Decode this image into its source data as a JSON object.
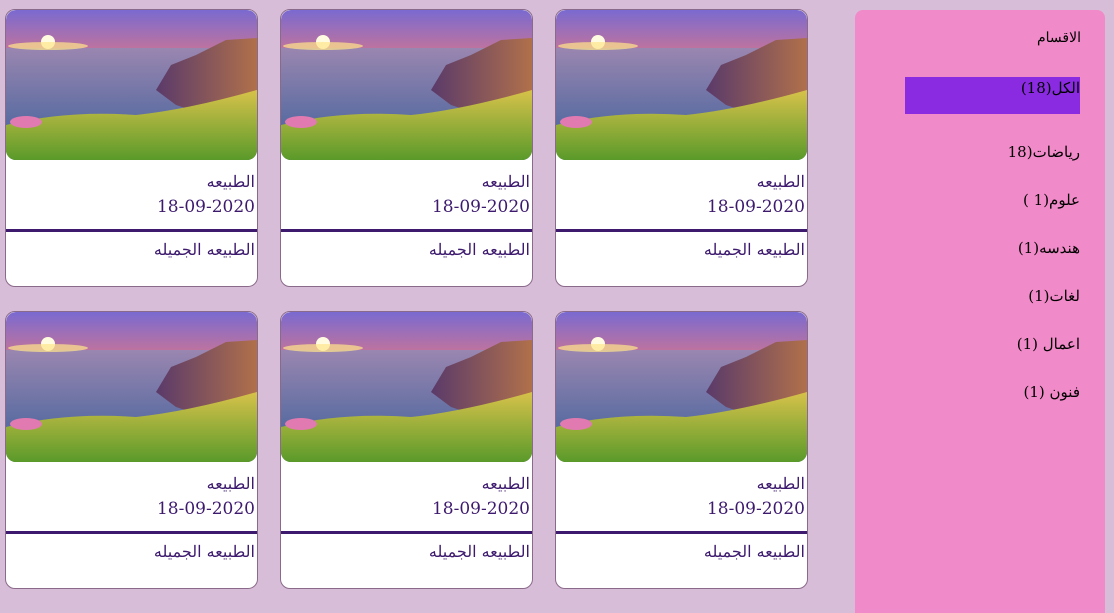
{
  "sidebar": {
    "title": "الاقسام",
    "items": [
      {
        "label": "الكل(18)",
        "active": true
      },
      {
        "label": "رياضات(18"
      },
      {
        "label": "علوم(1 )"
      },
      {
        "label": "هندسه(1)"
      },
      {
        "label": "لغات(1)"
      },
      {
        "label": "اعمال (1)"
      },
      {
        "label": "فنون (1)"
      }
    ]
  },
  "cards": [
    {
      "category": "الطبيعه",
      "date": "18-09-2020",
      "caption": "الطبيعه الجميله"
    },
    {
      "category": "الطبيعه",
      "date": "18-09-2020",
      "caption": "الطبيعه الجميله"
    },
    {
      "category": "الطبيعه",
      "date": "18-09-2020",
      "caption": "الطبيعه الجميله"
    },
    {
      "category": "الطبيعه",
      "date": "18-09-2020",
      "caption": "الطبيعه الجميله"
    },
    {
      "category": "الطبيعه",
      "date": "18-09-2020",
      "caption": "الطبيعه الجميله"
    },
    {
      "category": "الطبيعه",
      "date": "18-09-2020",
      "caption": "الطبيعه الجميله"
    }
  ],
  "colors": {
    "page_bg": "#d8bdd8",
    "sidebar_bg": "#f08ac8",
    "active_item_bg": "#8a2be2",
    "card_text": "#3d1a6e"
  }
}
